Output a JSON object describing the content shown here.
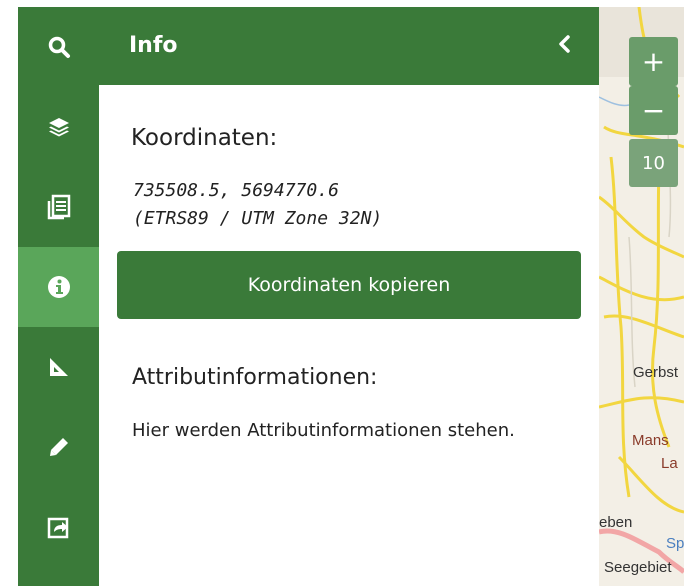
{
  "sidebar": {
    "items": [
      {
        "icon": "search-icon",
        "active": false
      },
      {
        "icon": "layers-icon",
        "active": false
      },
      {
        "icon": "document-list-icon",
        "active": false
      },
      {
        "icon": "info-icon",
        "active": true
      },
      {
        "icon": "measure-icon",
        "active": false
      },
      {
        "icon": "pencil-icon",
        "active": false
      },
      {
        "icon": "share-icon",
        "active": false
      }
    ]
  },
  "panel": {
    "title": "Info",
    "coordinates": {
      "heading": "Koordinaten:",
      "value": "735508.5, 5694770.6",
      "crs": "(ETRS89 / UTM Zone 32N)"
    },
    "copy_button": "Koordinaten kopieren",
    "attributes": {
      "heading": "Attributinformationen:",
      "text": "Hier werden Attributinformationen stehen."
    }
  },
  "map": {
    "zoom_in": "+",
    "zoom_out": "−",
    "zoom_level": "10",
    "labels": [
      "Gerbst",
      "Mans",
      "La",
      "eben",
      "Sp",
      "Seegebiet"
    ]
  },
  "colors": {
    "primary": "#3a7a39",
    "active": "#5aa65a",
    "zoom": "#6a9c6a"
  }
}
